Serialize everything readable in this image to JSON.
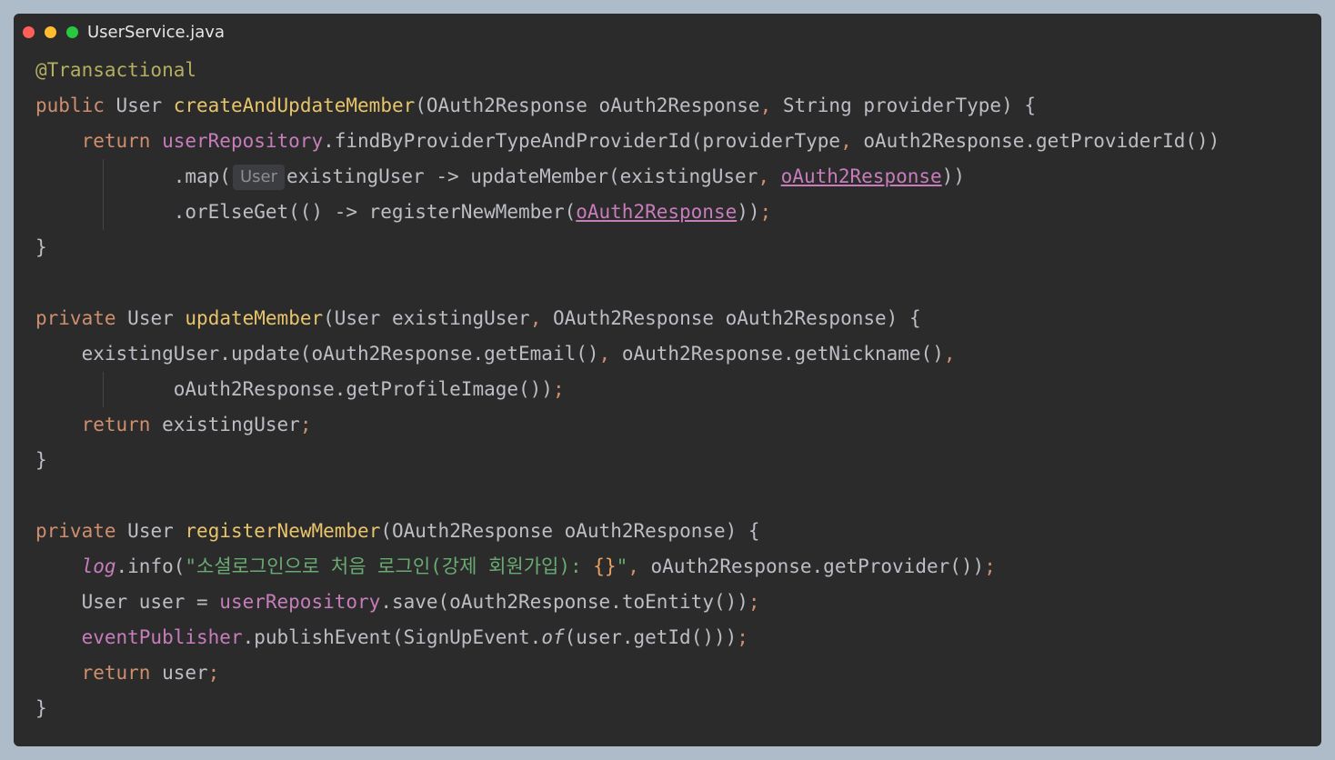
{
  "window": {
    "filename": "UserService.java",
    "colors": {
      "close": "#ff5f57",
      "minimize": "#febc2e",
      "zoom": "#28c840",
      "background": "#2b2b2c"
    }
  },
  "code": {
    "l1": {
      "annotation": "@Transactional"
    },
    "l2": {
      "kw": "public",
      "sp1": " ",
      "type": "User",
      "sp2": " ",
      "name": "createAndUpdateMember",
      "params": "(OAuth2Response oAuth2Response",
      "comma": ",",
      "rest": " String providerType) {"
    },
    "l3": {
      "indent": "    ",
      "kw": "return",
      "sp": " ",
      "field": "userRepository",
      "call": ".findByProviderTypeAndProviderId(providerType",
      "comma": ",",
      "rest": " oAuth2Response.getProviderId())"
    },
    "l4": {
      "indent": "            ",
      "call": ".map(",
      "hint": "User",
      "lambda": "existingUser -> updateMember(existingUser",
      "comma": ",",
      "sp": " ",
      "param": "oAuth2Response",
      "close": "))"
    },
    "l5": {
      "indent": "            ",
      "call": ".orElseGet(() -> registerNewMember(",
      "param": "oAuth2Response",
      "close": "))",
      "semi": ";"
    },
    "l6": {
      "brace": "}"
    },
    "l8": {
      "kw": "private",
      "sp1": " ",
      "type": "User",
      "sp2": " ",
      "name": "updateMember",
      "p1": "(User existingUser",
      "comma": ",",
      "rest": " OAuth2Response oAuth2Response) {"
    },
    "l9": {
      "indent": "    ",
      "call1": "existingUser.update(oAuth2Response.getEmail()",
      "comma1": ",",
      "call2": " oAuth2Response.getNickname()",
      "comma2": ","
    },
    "l10": {
      "indent": "            ",
      "call": "oAuth2Response.getProfileImage())",
      "semi": ";"
    },
    "l11": {
      "indent": "    ",
      "kw": "return",
      "rest": " existingUser",
      "semi": ";"
    },
    "l12": {
      "brace": "}"
    },
    "l14": {
      "kw": "private",
      "sp1": " ",
      "type": "User",
      "sp2": " ",
      "name": "registerNewMember",
      "rest": "(OAuth2Response oAuth2Response) {"
    },
    "l15": {
      "indent": "    ",
      "log": "log",
      "call": ".info(",
      "str1": "\"소셜로그인으로 처음 로그인(강제 회원가입): ",
      "placeholder": "{}",
      "str2": "\"",
      "comma": ",",
      "rest": " oAuth2Response.getProvider())",
      "semi": ";"
    },
    "l16": {
      "indent": "    ",
      "pre": "User user = ",
      "field": "userRepository",
      "rest": ".save(oAuth2Response.toEntity())",
      "semi": ";"
    },
    "l17": {
      "indent": "    ",
      "field": "eventPublisher",
      "call": ".publishEvent(SignUpEvent.",
      "of": "of",
      "rest": "(user.getId()))",
      "semi": ";"
    },
    "l18": {
      "indent": "    ",
      "kw": "return",
      "rest": " user",
      "semi": ";"
    },
    "l19": {
      "brace": "}"
    }
  }
}
